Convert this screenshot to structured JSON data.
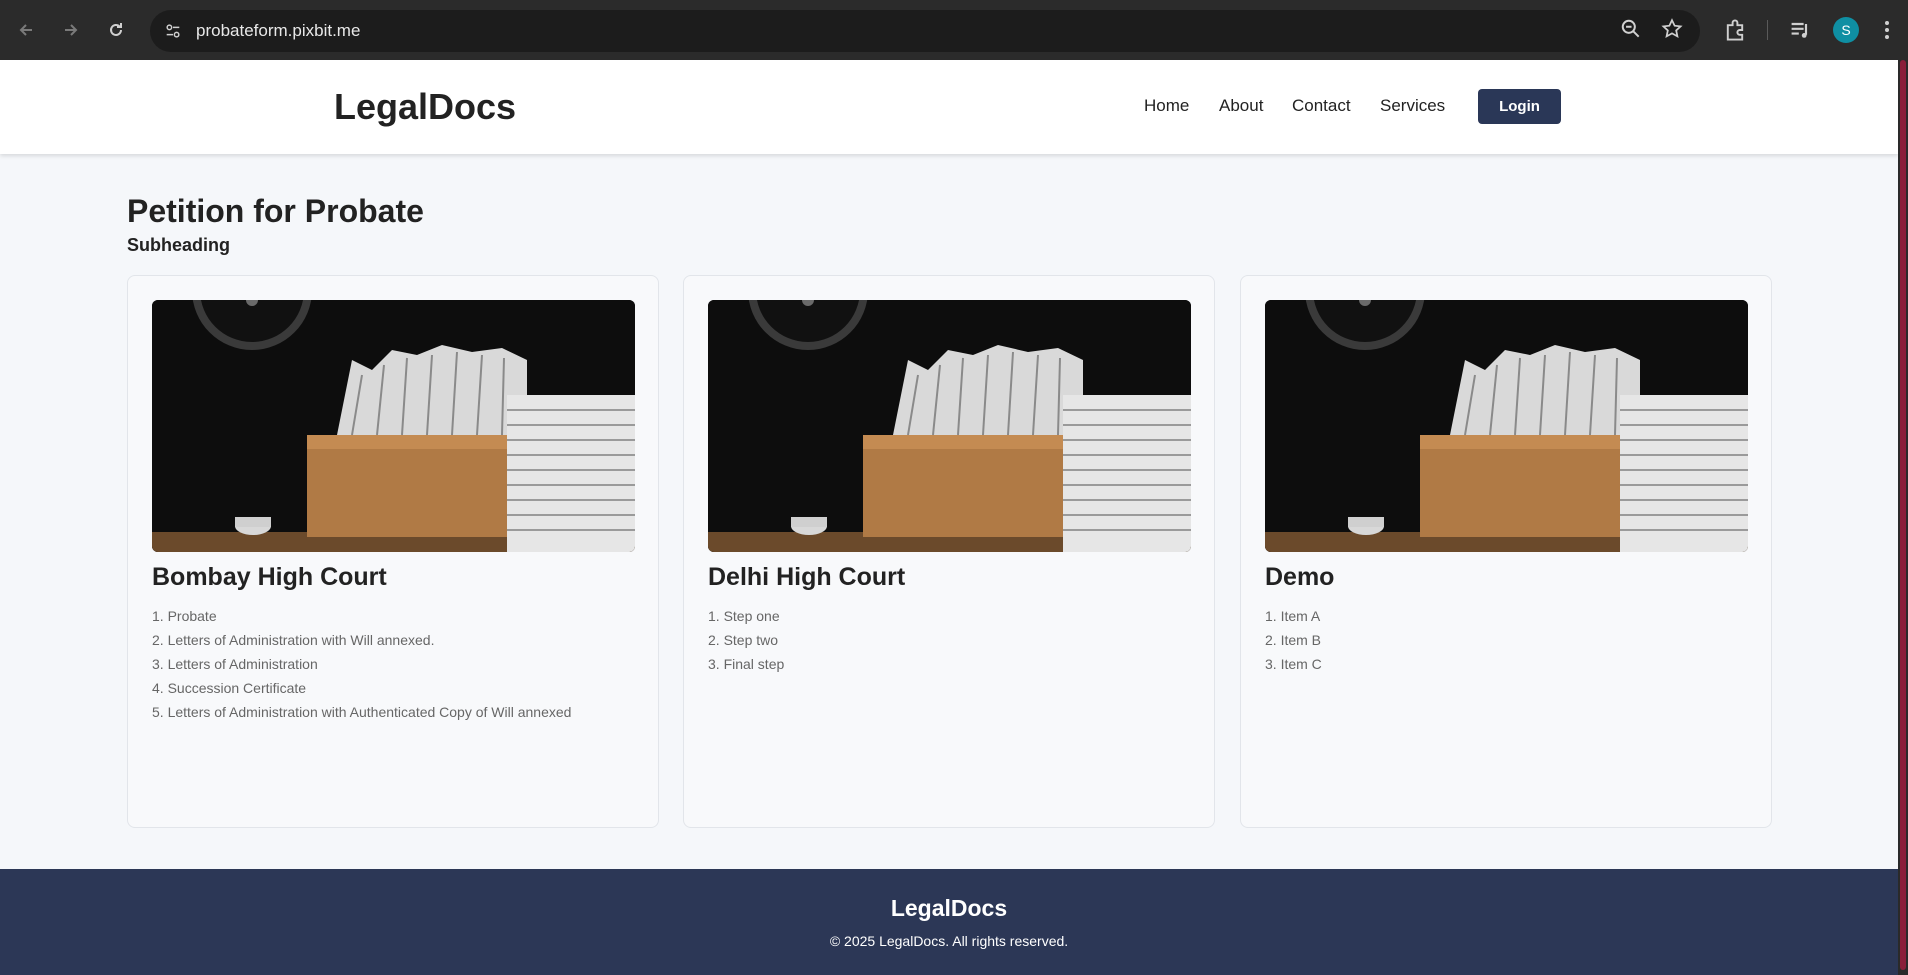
{
  "browser": {
    "url": "probateform.pixbit.me",
    "profile_initial": "S",
    "accent": "#0f8fa3"
  },
  "site": {
    "logo": "LegalDocs",
    "nav": [
      "Home",
      "About",
      "Contact",
      "Services"
    ],
    "login_label": "Login",
    "brand_color": "#2a3757"
  },
  "main": {
    "title": "Petition for Probate",
    "subheading": "Subheading",
    "cards": [
      {
        "title": "Bombay High Court",
        "items": [
          "1. Probate",
          "2. Letters of Administration with Will annexed.",
          "3. Letters of Administration",
          "4. Succession Certificate",
          "5. Letters of Administration with Authenticated Copy of Will annexed"
        ]
      },
      {
        "title": "Delhi High Court",
        "items": [
          "1. Step one",
          "2. Step two",
          "3. Final step"
        ]
      },
      {
        "title": "Demo",
        "items": [
          "1. Item A",
          "2. Item B",
          "3. Item C"
        ]
      }
    ]
  },
  "footer": {
    "logo": "LegalDocs",
    "copyright": "© 2025 LegalDocs. All rights reserved."
  }
}
